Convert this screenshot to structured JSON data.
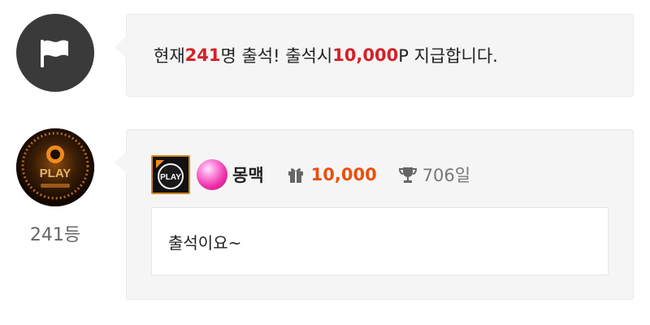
{
  "notice": {
    "icon": "flag-icon",
    "prefix": "현재 ",
    "count": "241",
    "middle": "명 출석! 출석시 ",
    "points": "10,000",
    "suffix": "P 지급합니다."
  },
  "entry": {
    "avatar_icon": "play-logo-avatar",
    "avatar_text": "PLAY",
    "rank": "241등",
    "level_icon": "play-level-badge",
    "level_badge_text": "PLAY",
    "decor_icon": "pink-ball-icon",
    "nickname": "몽맥",
    "gift_icon": "gift-icon",
    "points": "10,000",
    "trophy_icon": "trophy-icon",
    "days": "706일",
    "comment": "출석이요~"
  },
  "colors": {
    "accent_red": "#d42127",
    "points_orange": "#e8500e",
    "bubble_bg": "#f5f5f5",
    "icon_dark": "#3a3a3a"
  }
}
